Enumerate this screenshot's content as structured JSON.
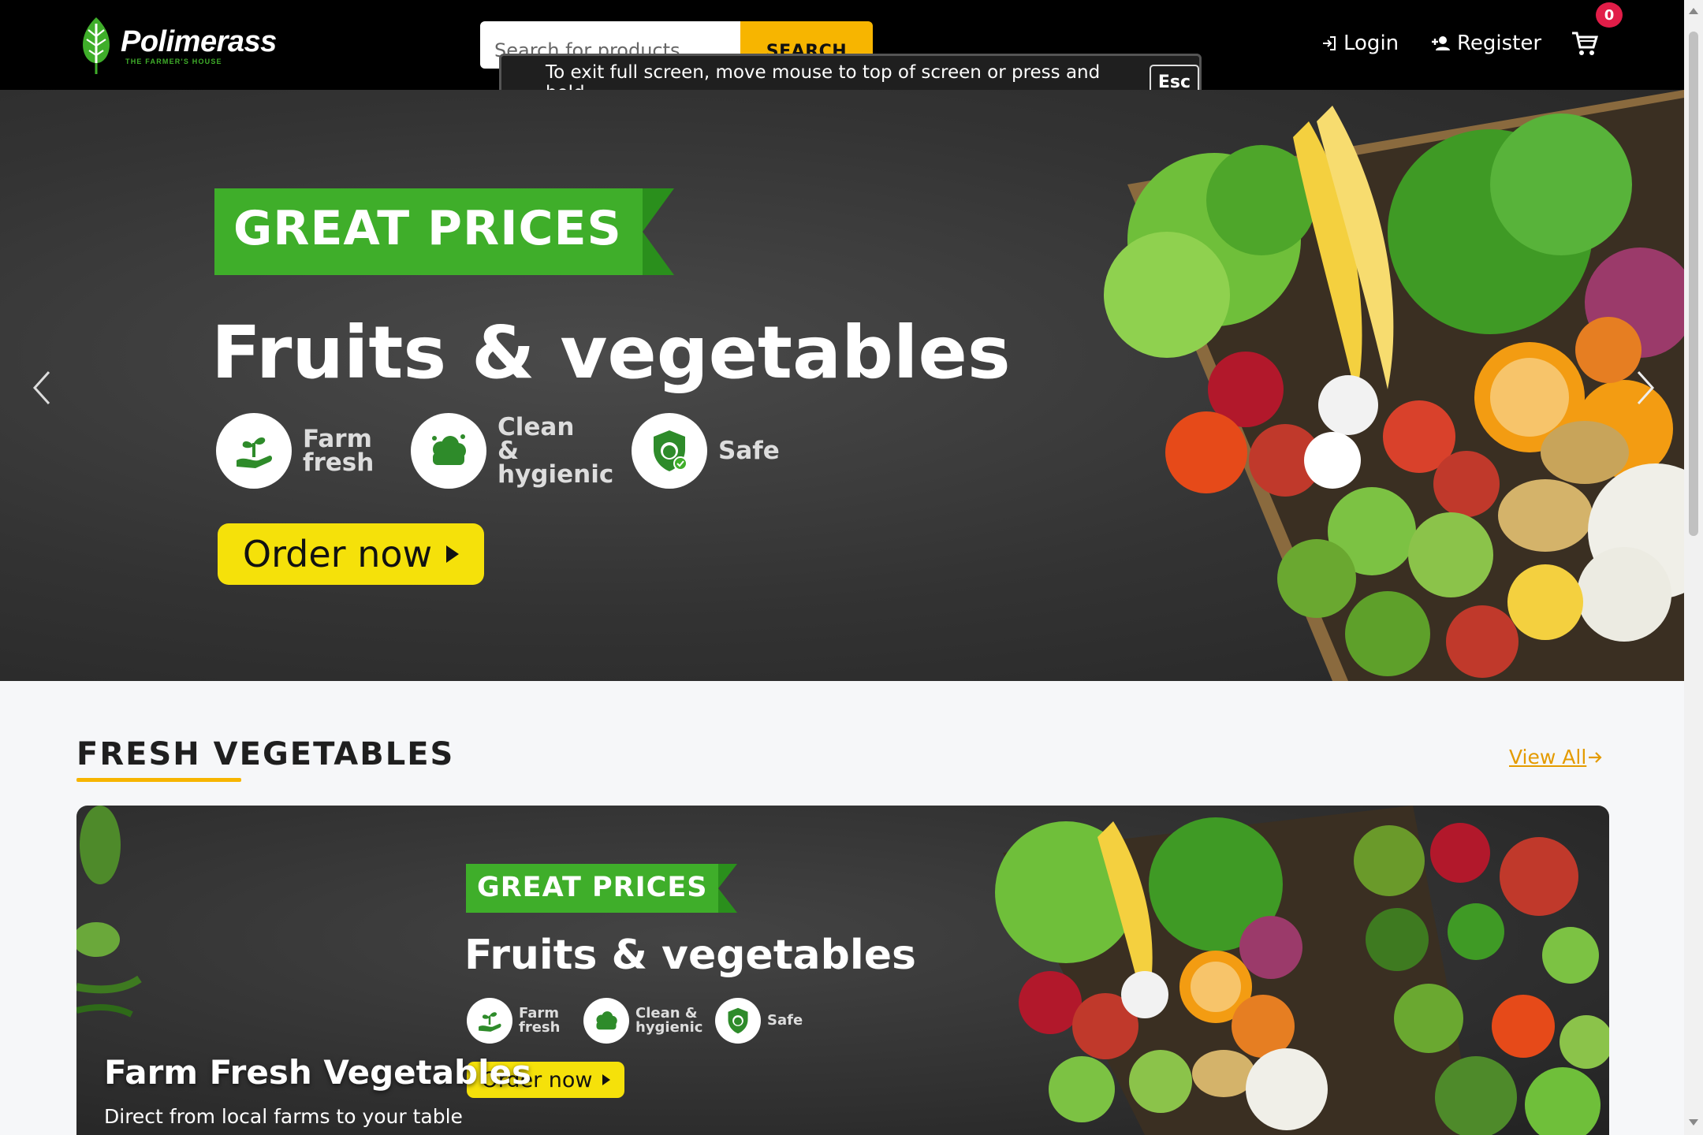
{
  "brand": {
    "name": "Polimerass",
    "tagline": "THE FARMER'S HOUSE",
    "accent": "#3fae2a"
  },
  "search": {
    "placeholder": "Search for products...",
    "button_label": "SEARCH",
    "button_color": "#f7b500"
  },
  "nav": {
    "login_label": "Login",
    "register_label": "Register",
    "cart_count": "0",
    "icons": [
      "login-icon",
      "register-icon",
      "cart-icon"
    ]
  },
  "fullscreen_notice": {
    "message": "To exit full screen, move mouse to top of screen or press and hold",
    "key": "Esc"
  },
  "hero": {
    "ribbon": "GREAT PRICES",
    "headline": "Fruits & vegetables",
    "features": [
      {
        "label": "Farm fresh",
        "icon": "hand-plant-icon"
      },
      {
        "label": "Clean & hygienic",
        "icon": "clean-veg-icon"
      },
      {
        "label": "Safe",
        "icon": "safe-apple-icon"
      }
    ],
    "order_label": "Order now"
  },
  "section": {
    "title": "FRESH VEGETABLES",
    "view_all": "View All",
    "card": {
      "ribbon": "GREAT PRICES",
      "headline": "Fruits & vegetables",
      "features": [
        {
          "label": "Farm fresh"
        },
        {
          "label": "Clean & hygienic"
        },
        {
          "label": "Safe"
        }
      ],
      "order_label": "Order now",
      "title": "Farm Fresh Vegetables",
      "subtitle": "Direct from local farms to your table"
    }
  }
}
